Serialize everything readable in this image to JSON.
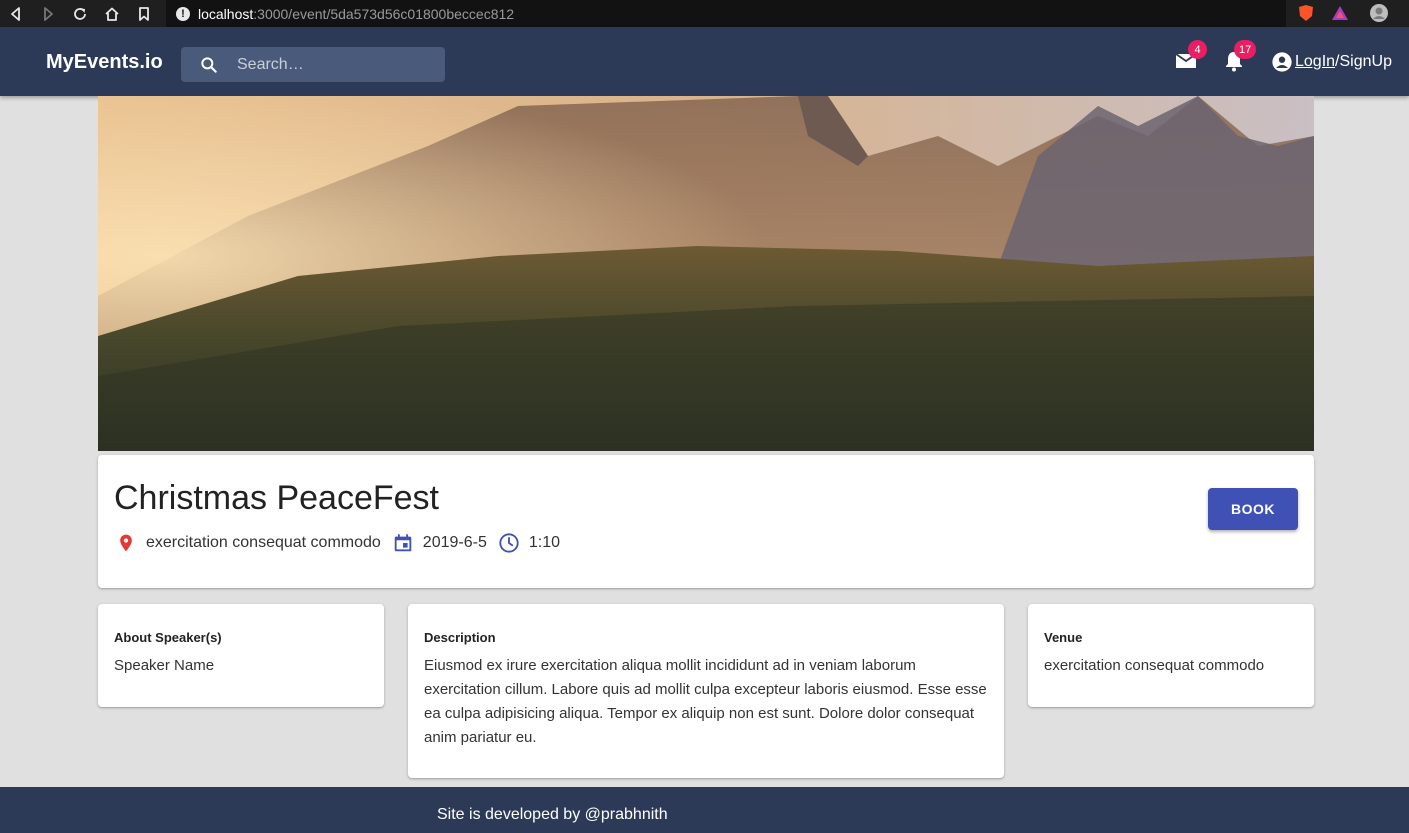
{
  "browser": {
    "url_host": "localhost",
    "url_path": ":3000/event/5da573d56c01800beccec812"
  },
  "appbar": {
    "brand": "MyEvents.io",
    "search_placeholder": "Search…",
    "mail_badge": "4",
    "notifications_badge": "17",
    "login_label": "LogIn",
    "signup_label": "/SignUp"
  },
  "event": {
    "title": "Christmas PeaceFest",
    "location": "exercitation consequat commodo",
    "date": "2019-6-5",
    "time": "1:10",
    "book_label": "BOOK"
  },
  "speaker": {
    "heading": "About Speaker(s)",
    "name": "Speaker Name"
  },
  "description": {
    "heading": "Description",
    "text": "Eiusmod ex irure exercitation aliqua mollit incididunt ad in veniam laborum exercitation cillum. Labore quis ad mollit culpa excepteur laboris eiusmod. Esse esse ea culpa adipisicing aliqua. Tempor ex aliquip non est sunt. Dolore dolor consequat anim pariatur eu."
  },
  "venue": {
    "heading": "Venue",
    "text": "exercitation consequat commodo"
  },
  "footer": {
    "text": "Site is developed by @prabhnith"
  },
  "colors": {
    "appbar": "#2c3a58",
    "primary": "#3f51b5",
    "badge": "#e91e63",
    "location_pin": "#e53935"
  }
}
